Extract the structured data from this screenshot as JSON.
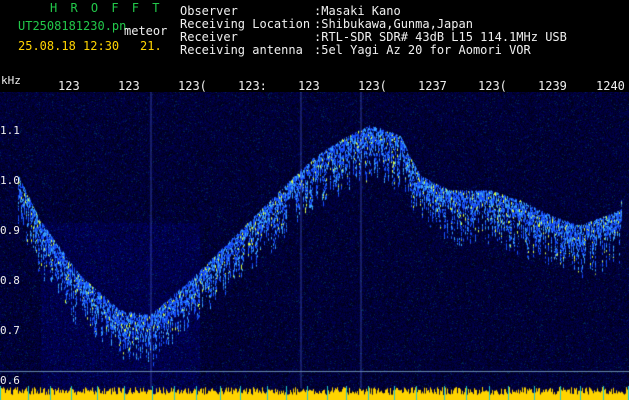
{
  "header": {
    "station_name": "H R O F F T",
    "filename": "UT2508181230.pn",
    "meteor_label": "meteor",
    "datetime": "25.08.18 12:30",
    "count": "21.",
    "field_labels": [
      "Observer",
      "Receiving Location",
      "Receiver",
      "Receiving antenna"
    ],
    "field_values": [
      ":Masaki Kano",
      ":Shibukawa,Gunma,Japan",
      ":RTL-SDR SDR# 43dB L15 114.1MHz USB",
      ":5el Yagi Az 20 for Aomori VOR"
    ]
  },
  "axis": {
    "unit": "kHz",
    "y_ticks": [
      "1.1",
      "1.0",
      "0.9",
      "0.8",
      "0.7",
      "0.6"
    ],
    "x_ticks": [
      "123",
      "123",
      "123(",
      "123:",
      "123",
      "123(",
      "1237",
      "123(",
      "1239",
      "1240"
    ]
  },
  "colors": {
    "background": "#00003a",
    "signal": "#3aa6ff",
    "noise_bar": "#ffd400",
    "header_green": "#22c84a"
  }
}
